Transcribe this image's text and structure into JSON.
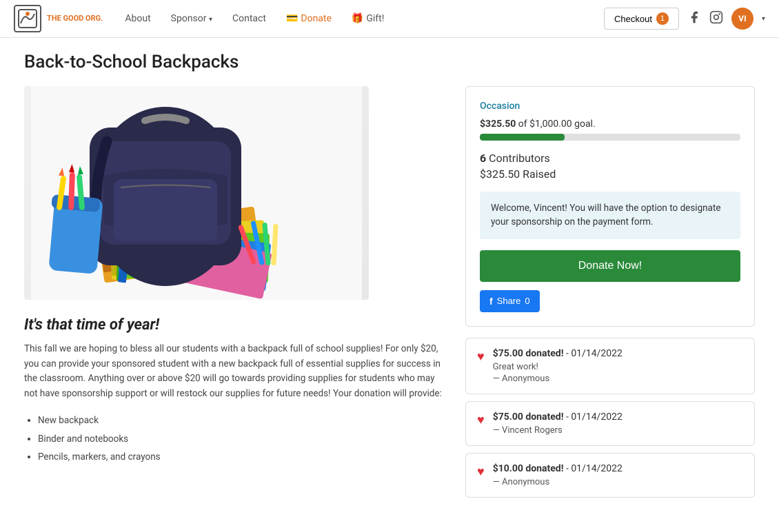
{
  "brand": {
    "logo_alt": "The Good Org logo",
    "name": "THE GOOD ORG."
  },
  "navbar": {
    "about_label": "About",
    "sponsor_label": "Sponsor",
    "contact_label": "Contact",
    "donate_label": "Donate",
    "gift_label": "Gift!",
    "checkout_label": "Checkout",
    "checkout_count": "1",
    "user_initials": "VI"
  },
  "page": {
    "title": "Back-to-School Backpacks"
  },
  "campaign": {
    "subtitle": "It's that time of year!",
    "description": "This fall we are hoping to bless all our students with a backpack full of school supplies! For only $20, you can provide your sponsored student with a new backpack full of essential supplies for success in the classroom. Anything over or above $20 will go towards providing supplies for students who may not have sponsorship support or will restock our supplies for future needs! Your donation will provide:",
    "supplies": [
      "New backpack",
      "Binder and notebooks",
      "Pencils, markers, and crayons"
    ]
  },
  "donation_panel": {
    "occasion_label": "Occasion",
    "raised_amount": "$325.50",
    "goal_amount": "$1,000.00",
    "goal_suffix": "goal.",
    "progress_percent": 32.55,
    "contributors_count": "6",
    "contributors_label": "Contributors",
    "raised_label": "Raised",
    "welcome_message": "Welcome, Vincent! You will have the option to designate your sponsorship on the payment form.",
    "donate_button": "Donate Now!",
    "share_button": "Share",
    "share_count": "0"
  },
  "donations": [
    {
      "amount": "$75.00 donated!",
      "date": "01/14/2022",
      "message": "Great work!",
      "donor": "— Anonymous"
    },
    {
      "amount": "$75.00 donated!",
      "date": "01/14/2022",
      "message": null,
      "donor": "— Vincent Rogers"
    },
    {
      "amount": "$10.00 donated!",
      "date": "01/14/2022",
      "message": null,
      "donor": "— Anonymous"
    }
  ]
}
